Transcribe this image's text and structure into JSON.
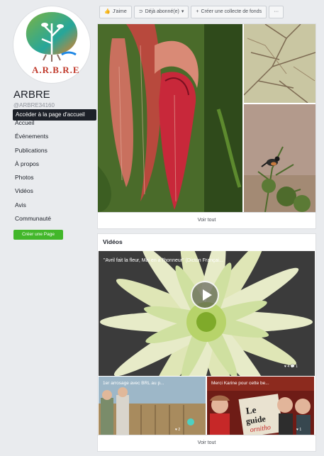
{
  "page": {
    "logo_text": "A.R.B.R.E",
    "name": "ARBRE",
    "handle": "@ARBRE34160",
    "tooltip": "Accéder à la page d'accueil"
  },
  "nav": [
    {
      "label": "Accueil"
    },
    {
      "label": "Événements"
    },
    {
      "label": "Publications"
    },
    {
      "label": "À propos"
    },
    {
      "label": "Photos"
    },
    {
      "label": "Vidéos"
    },
    {
      "label": "Avis"
    },
    {
      "label": "Communauté"
    }
  ],
  "create_page_label": "Créer une Page",
  "actions": {
    "like": "J'aime",
    "following": "Déjà abonné(e)",
    "fundraiser": "Créer une collecte de fonds",
    "more": "···"
  },
  "photos": {
    "see_all": "Voir tout"
  },
  "videos": {
    "title": "Vidéos",
    "main_caption": "\"Avril fait la fleur, Mai en a l'honneur\" (Dicton Françai...",
    "main_stats": "♥ 4   💬 1",
    "thumb1_caption": "1er arrosage avec BRL au p...",
    "thumb1_stats": "♥ 2",
    "thumb2_caption": "Merci Karine pour cette be...",
    "thumb2_stats": "♥ 1",
    "see_all": "Voir tout"
  },
  "colors": {
    "fb_background": "#e9ebee",
    "create_button": "#42b72a",
    "logo_red": "#c0392b"
  }
}
